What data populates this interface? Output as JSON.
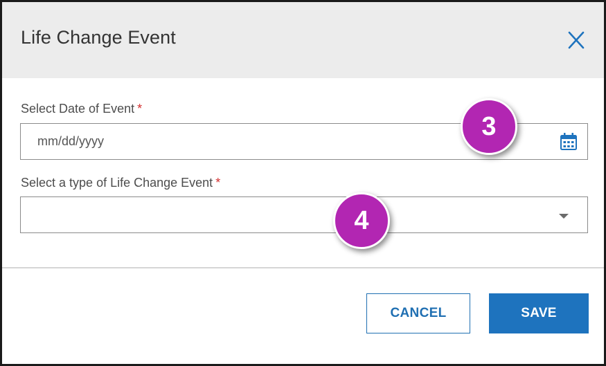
{
  "dialog": {
    "title": "Life Change Event",
    "close_icon": "close-icon"
  },
  "form": {
    "date_field": {
      "label": "Select Date of Event",
      "required_mark": "*",
      "value": "",
      "placeholder": "mm/dd/yyyy",
      "icon": "calendar-icon"
    },
    "type_field": {
      "label": "Select a type of Life Change Event",
      "required_mark": "*",
      "selected_value": "",
      "icon": "chevron-down-icon"
    }
  },
  "footer": {
    "cancel_label": "CANCEL",
    "save_label": "SAVE"
  },
  "annotations": {
    "step_3": "3",
    "step_4": "4"
  },
  "colors": {
    "header_bg": "#ececec",
    "accent": "#1e73be",
    "required": "#d32f2f",
    "badge": "#b226b2"
  }
}
